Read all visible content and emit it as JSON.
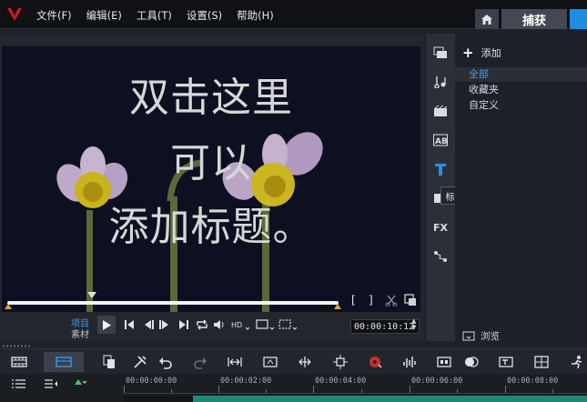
{
  "menubar": {
    "items": [
      "文件(F)",
      "编辑(E)",
      "工具(T)",
      "设置(S)",
      "帮助(H)"
    ],
    "capture_tab": "捕获",
    "accent": "#1f8de0"
  },
  "preview": {
    "lines": [
      "双击这里",
      "可以",
      "添加标题。"
    ]
  },
  "player": {
    "mode_project": "项目",
    "mode_clip": "素材",
    "timecode": "00:00:10:12",
    "mark_in": "[",
    "mark_out": "]"
  },
  "library": {
    "add_label": "添加",
    "items": [
      "全部",
      "收藏夹",
      "自定义"
    ],
    "tooltip": "标题",
    "fx_label": "FX",
    "browse_label": "浏览"
  },
  "timeline": {
    "ruler": [
      "00:00:00:00",
      "00:00:02:00",
      "00:00:04:00",
      "00:00:06:00",
      "00:00:08:00"
    ]
  }
}
